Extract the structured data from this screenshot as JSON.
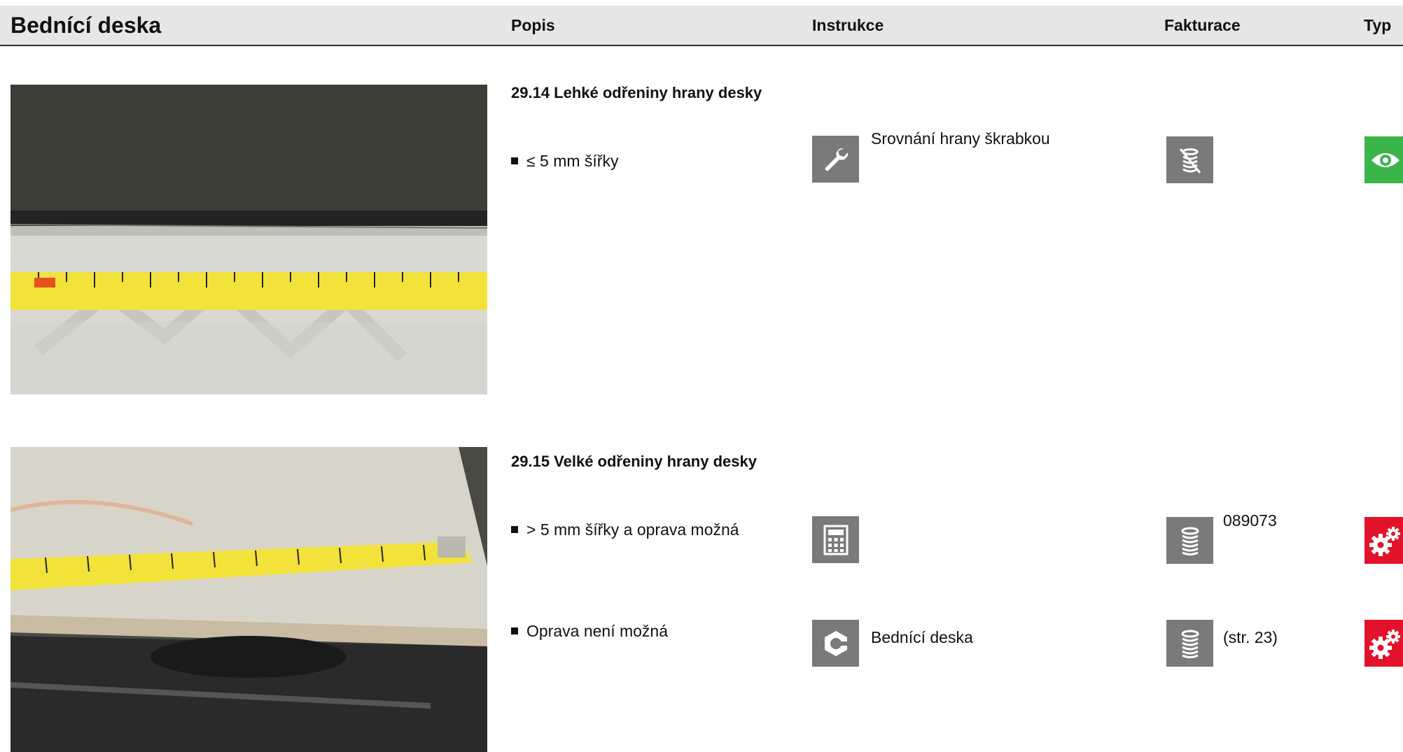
{
  "header": {
    "title": "Bednící deska",
    "col_popis": "Popis",
    "col_instrukce": "Instrukce",
    "col_fakturace": "Fakturace",
    "col_typ": "Typ"
  },
  "section1": {
    "title": "29.14 Lehké odřeniny hrany desky",
    "items": [
      {
        "popis": "≤ 5 mm šířky",
        "instrukce": "Srovnání hrany škrabkou",
        "instrukce_icon": "wrench-icon",
        "fakturace": "",
        "fakturace_icon": "no-billing-coins-icon",
        "typ_icon": "eye-icon"
      }
    ]
  },
  "section2": {
    "title": "29.15 Velké odřeniny hrany desky",
    "items": [
      {
        "popis": "> 5 mm šířky a oprava možná",
        "instrukce": "",
        "instrukce_icon": "calculator-icon",
        "fakturace": "089073",
        "fakturace_icon": "coins-icon",
        "typ_icon": "gears-icon"
      },
      {
        "popis": "Oprava není možná",
        "instrukce": "Bednící deska",
        "instrukce_icon": "hex-nut-icon",
        "fakturace": "(str. 23)",
        "fakturace_icon": "coins-icon",
        "typ_icon": "gears-icon"
      }
    ]
  },
  "colors": {
    "icon_gray": "#7a7a7a",
    "type_green": "#3ab54a",
    "type_red": "#e3122b",
    "header_bg": "#e6e6e6"
  }
}
